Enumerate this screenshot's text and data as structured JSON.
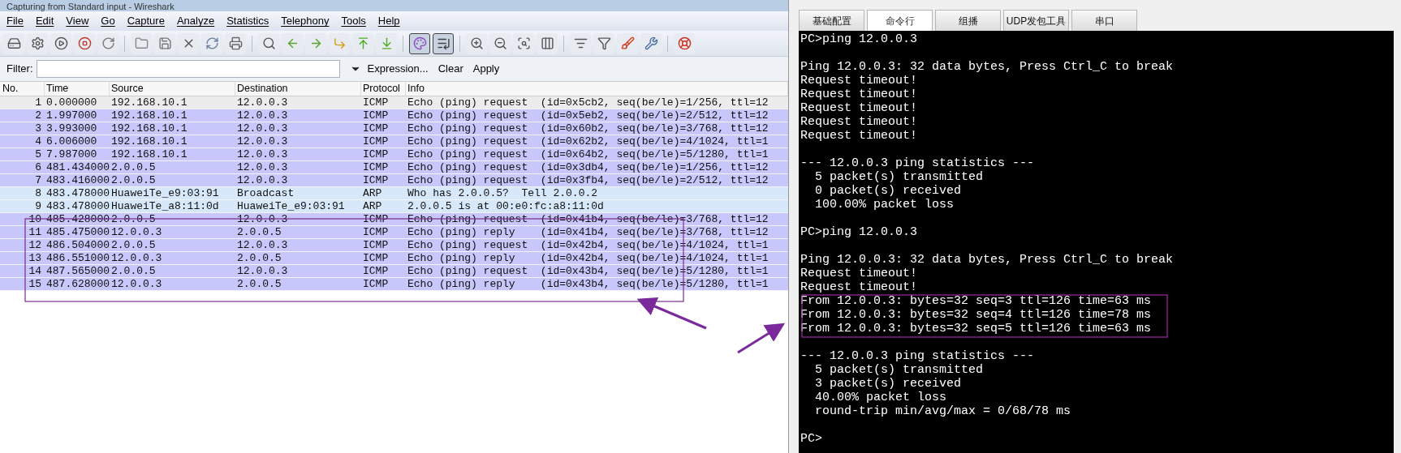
{
  "window": {
    "title": "Capturing from Standard input - Wireshark"
  },
  "menu": [
    "File",
    "Edit",
    "View",
    "Go",
    "Capture",
    "Analyze",
    "Statistics",
    "Telephony",
    "Tools",
    "Help"
  ],
  "toolbar": [
    {
      "kind": "interfaces",
      "pressed": false
    },
    {
      "kind": "options",
      "pressed": false
    },
    {
      "kind": "start",
      "pressed": false
    },
    {
      "kind": "stop",
      "pressed": false
    },
    {
      "kind": "restart",
      "pressed": false
    },
    {
      "kind": "separator"
    },
    {
      "kind": "open",
      "pressed": false
    },
    {
      "kind": "save",
      "pressed": false
    },
    {
      "kind": "close",
      "pressed": false
    },
    {
      "kind": "reload",
      "pressed": false
    },
    {
      "kind": "print",
      "pressed": false
    },
    {
      "kind": "separator"
    },
    {
      "kind": "find",
      "pressed": false
    },
    {
      "kind": "back",
      "pressed": false
    },
    {
      "kind": "forward",
      "pressed": false
    },
    {
      "kind": "goto",
      "pressed": false
    },
    {
      "kind": "first",
      "pressed": false
    },
    {
      "kind": "last",
      "pressed": false
    },
    {
      "kind": "separator"
    },
    {
      "kind": "colorize",
      "pressed": true
    },
    {
      "kind": "autoscroll",
      "pressed": true
    },
    {
      "kind": "separator"
    },
    {
      "kind": "zoomin",
      "pressed": false
    },
    {
      "kind": "zoomout",
      "pressed": false
    },
    {
      "kind": "zoomreset",
      "pressed": false
    },
    {
      "kind": "resize",
      "pressed": false
    },
    {
      "kind": "separator"
    },
    {
      "kind": "capfilter",
      "pressed": false
    },
    {
      "kind": "dispfilter",
      "pressed": false
    },
    {
      "kind": "coloring",
      "pressed": false
    },
    {
      "kind": "prefs",
      "pressed": false
    },
    {
      "kind": "separator"
    },
    {
      "kind": "help",
      "pressed": false
    }
  ],
  "filter": {
    "label": "Filter:",
    "links": [
      "Expression...",
      "Clear",
      "Apply"
    ]
  },
  "packets": {
    "columns": [
      "No.",
      "Time",
      "Source",
      "Destination",
      "Protocol",
      "Info"
    ],
    "rows": [
      {
        "cells": [
          "1",
          "0.000000",
          "192.168.10.1",
          "12.0.0.3",
          "ICMP",
          "Echo (ping) request  (id=0x5cb2, seq(be/le)=1/256, ttl=12"
        ],
        "color": "#ececec"
      },
      {
        "cells": [
          "2",
          "1.997000",
          "192.168.10.1",
          "12.0.0.3",
          "ICMP",
          "Echo (ping) request  (id=0x5eb2, seq(be/le)=2/512, ttl=12"
        ],
        "color": "#c7c7fb"
      },
      {
        "cells": [
          "3",
          "3.993000",
          "192.168.10.1",
          "12.0.0.3",
          "ICMP",
          "Echo (ping) request  (id=0x60b2, seq(be/le)=3/768, ttl=12"
        ],
        "color": "#c7c7fb"
      },
      {
        "cells": [
          "4",
          "6.006000",
          "192.168.10.1",
          "12.0.0.3",
          "ICMP",
          "Echo (ping) request  (id=0x62b2, seq(be/le)=4/1024, ttl=1"
        ],
        "color": "#c7c7fb"
      },
      {
        "cells": [
          "5",
          "7.987000",
          "192.168.10.1",
          "12.0.0.3",
          "ICMP",
          "Echo (ping) request  (id=0x64b2, seq(be/le)=5/1280, ttl=1"
        ],
        "color": "#c7c7fb"
      },
      {
        "cells": [
          "6",
          "481.434000",
          "2.0.0.5",
          "12.0.0.3",
          "ICMP",
          "Echo (ping) request  (id=0x3db4, seq(be/le)=1/256, ttl=12"
        ],
        "color": "#c7c7fb"
      },
      {
        "cells": [
          "7",
          "483.416000",
          "2.0.0.5",
          "12.0.0.3",
          "ICMP",
          "Echo (ping) request  (id=0x3fb4, seq(be/le)=2/512, ttl=12"
        ],
        "color": "#c7c7fb"
      },
      {
        "cells": [
          "8",
          "483.478000",
          "HuaweiTe_e9:03:91",
          "Broadcast",
          "ARP",
          "Who has 2.0.0.5?  Tell 2.0.0.2"
        ],
        "color": "#d7e8fb"
      },
      {
        "cells": [
          "9",
          "483.478000",
          "HuaweiTe_a8:11:0d",
          "HuaweiTe_e9:03:91",
          "ARP",
          "2.0.0.5 is at 00:e0:fc:a8:11:0d"
        ],
        "color": "#d7e8fb"
      },
      {
        "cells": [
          "10",
          "485.428000",
          "2.0.0.5",
          "12.0.0.3",
          "ICMP",
          "Echo (ping) request  (id=0x41b4, seq(be/le)=3/768, ttl=12"
        ],
        "color": "#c7c7fb"
      },
      {
        "cells": [
          "11",
          "485.475000",
          "12.0.0.3",
          "2.0.0.5",
          "ICMP",
          "Echo (ping) reply    (id=0x41b4, seq(be/le)=3/768, ttl=12"
        ],
        "color": "#c7c7fb"
      },
      {
        "cells": [
          "12",
          "486.504000",
          "2.0.0.5",
          "12.0.0.3",
          "ICMP",
          "Echo (ping) request  (id=0x42b4, seq(be/le)=4/1024, ttl=1"
        ],
        "color": "#c7c7fb"
      },
      {
        "cells": [
          "13",
          "486.551000",
          "12.0.0.3",
          "2.0.0.5",
          "ICMP",
          "Echo (ping) reply    (id=0x42b4, seq(be/le)=4/1024, ttl=1"
        ],
        "color": "#c7c7fb"
      },
      {
        "cells": [
          "14",
          "487.565000",
          "2.0.0.5",
          "12.0.0.3",
          "ICMP",
          "Echo (ping) request  (id=0x43b4, seq(be/le)=5/1280, ttl=1"
        ],
        "color": "#c7c7fb"
      },
      {
        "cells": [
          "15",
          "487.628000",
          "12.0.0.3",
          "2.0.0.5",
          "ICMP",
          "Echo (ping) reply    (id=0x43b4, seq(be/le)=5/1280, ttl=1"
        ],
        "color": "#c7c7fb"
      }
    ]
  },
  "tabs": [
    {
      "label": "基础配置",
      "selected": false
    },
    {
      "label": "命令行",
      "selected": true
    },
    {
      "label": "组播",
      "selected": false
    },
    {
      "label": "UDP发包工具",
      "selected": false
    },
    {
      "label": "串口",
      "selected": false
    }
  ],
  "terminal": {
    "lines": [
      {
        "kind": "text",
        "text": "PC>ping 12.0.0.3"
      },
      {
        "kind": "blank"
      },
      {
        "kind": "text",
        "text": "Ping 12.0.0.3: 32 data bytes, Press Ctrl_C to break"
      },
      {
        "kind": "text",
        "text": "Request timeout!"
      },
      {
        "kind": "text",
        "text": "Request timeout!"
      },
      {
        "kind": "text",
        "text": "Request timeout!"
      },
      {
        "kind": "text",
        "text": "Request timeout!"
      },
      {
        "kind": "text",
        "text": "Request timeout!"
      },
      {
        "kind": "blank"
      },
      {
        "kind": "text",
        "text": "--- 12.0.0.3 ping statistics ---"
      },
      {
        "kind": "text",
        "text": "  5 packet(s) transmitted"
      },
      {
        "kind": "text",
        "text": "  0 packet(s) received"
      },
      {
        "kind": "text",
        "text": "  100.00% packet loss"
      },
      {
        "kind": "blank"
      },
      {
        "kind": "text",
        "text": "PC>ping 12.0.0.3"
      },
      {
        "kind": "blank"
      },
      {
        "kind": "text",
        "text": "Ping 12.0.0.3: 32 data bytes, Press Ctrl_C to break"
      },
      {
        "kind": "text",
        "text": "Request timeout!"
      },
      {
        "kind": "text",
        "text": "Request timeout!"
      },
      {
        "kind": "text",
        "text": "From 12.0.0.3: bytes=32 seq=3 ttl=126 time=63 ms"
      },
      {
        "kind": "text",
        "text": "From 12.0.0.3: bytes=32 seq=4 ttl=126 time=78 ms"
      },
      {
        "kind": "text",
        "text": "From 12.0.0.3: bytes=32 seq=5 ttl=126 time=63 ms"
      },
      {
        "kind": "blank"
      },
      {
        "kind": "text",
        "text": "--- 12.0.0.3 ping statistics ---"
      },
      {
        "kind": "text",
        "text": "  5 packet(s) transmitted"
      },
      {
        "kind": "text",
        "text": "  3 packet(s) received"
      },
      {
        "kind": "text",
        "text": "  40.00% packet loss"
      },
      {
        "kind": "text",
        "text": "  round-trip min/avg/max = 0/68/78 ms"
      },
      {
        "kind": "blank"
      },
      {
        "kind": "text",
        "text": "PC>"
      }
    ]
  }
}
